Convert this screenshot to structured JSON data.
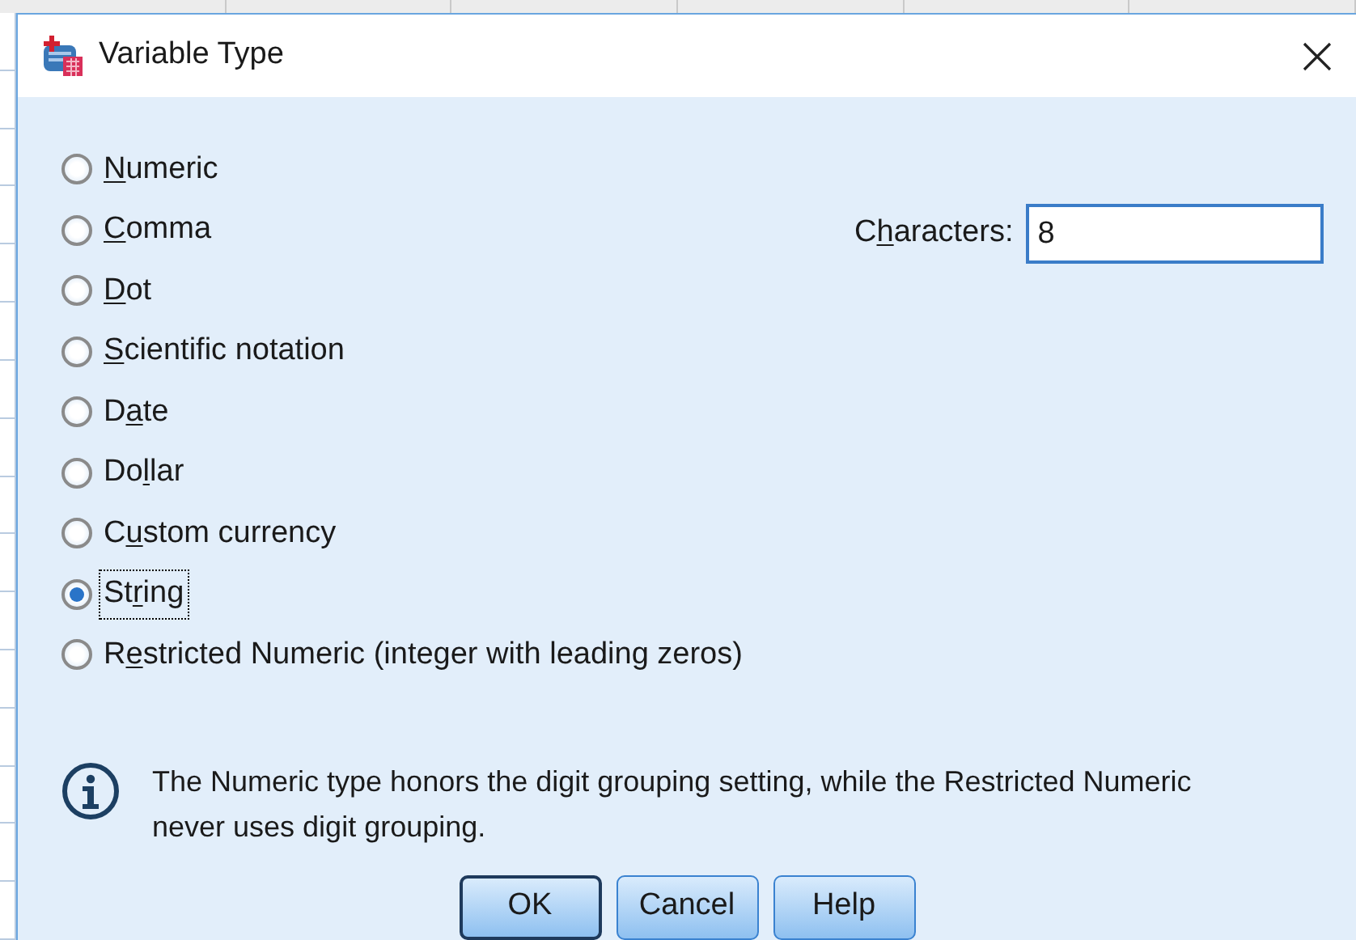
{
  "window": {
    "title": "Variable Type"
  },
  "types": [
    {
      "label": {
        "key": "N",
        "after": "umeric"
      },
      "selected": false,
      "focused": false
    },
    {
      "label": {
        "key": "C",
        "after": "omma"
      },
      "selected": false,
      "focused": false
    },
    {
      "label": {
        "key": "D",
        "after": "ot"
      },
      "selected": false,
      "focused": false
    },
    {
      "label": {
        "key": "S",
        "after": "cientific notation"
      },
      "selected": false,
      "focused": false
    },
    {
      "label": {
        "before": "D",
        "key": "a",
        "after": "te"
      },
      "selected": false,
      "focused": false
    },
    {
      "label": {
        "before": "Do",
        "key": "l",
        "after": "lar"
      },
      "selected": false,
      "focused": false
    },
    {
      "label": {
        "before": "C",
        "key": "u",
        "after": "stom currency"
      },
      "selected": false,
      "focused": false
    },
    {
      "label": {
        "before": "St",
        "key": "r",
        "after": "ing"
      },
      "selected": true,
      "focused": true
    },
    {
      "label": {
        "before": "R",
        "key": "e",
        "after": "stricted Numeric (integer with leading zeros)"
      },
      "selected": false,
      "focused": false
    }
  ],
  "characters": {
    "label": {
      "before": "C",
      "key": "h",
      "after": "aracters:"
    },
    "value": "8"
  },
  "info": "The Numeric type honors the digit grouping setting, while the Restricted Numeric never uses digit grouping.",
  "buttons": [
    {
      "label": "OK",
      "default": true
    },
    {
      "label": "Cancel",
      "default": false
    },
    {
      "label": "Help",
      "default": false
    }
  ]
}
